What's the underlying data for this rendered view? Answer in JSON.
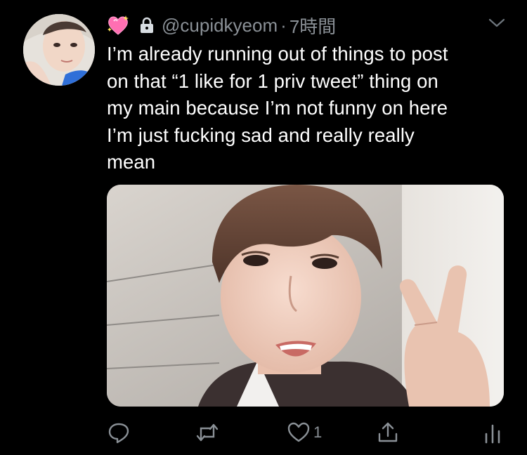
{
  "tweet": {
    "handle": "@cupidkyeom",
    "separator": "·",
    "time": "7時間",
    "text": "I’m already running out of things to post\non that “1 like for 1 priv tweet” thing on\nmy main because I’m not funny on here\nI’m just fucking sad and really really\nmean",
    "like_count": "1"
  },
  "icons": {
    "emoji": "sparkling-heart-icon",
    "lock": "lock-icon",
    "menu": "chevron-down-icon",
    "reply": "reply-icon",
    "retweet": "retweet-icon",
    "like": "heart-icon",
    "share": "share-icon",
    "analytics": "analytics-icon"
  },
  "colors": {
    "background": "#000000",
    "text": "#ffffff",
    "muted": "#8a9096"
  }
}
